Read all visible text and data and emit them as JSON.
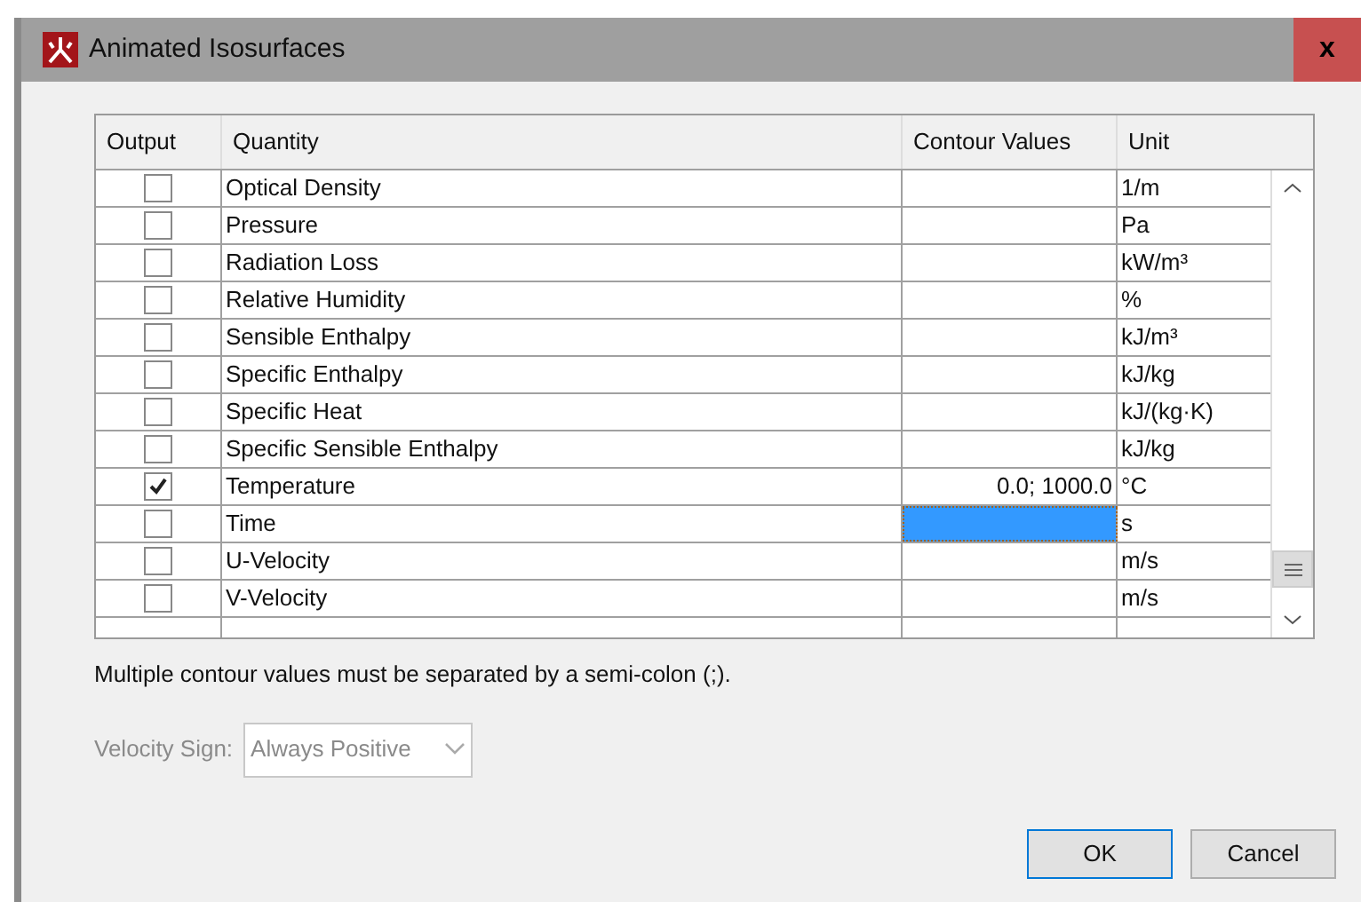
{
  "window": {
    "title": "Animated Isosurfaces",
    "close": "x"
  },
  "table": {
    "columns": [
      "Output",
      "Quantity",
      "Contour Values",
      "Unit"
    ],
    "rows": [
      {
        "checked": false,
        "quantity": "Optical Density",
        "contour_values": "",
        "unit": "1/m",
        "focused": false
      },
      {
        "checked": false,
        "quantity": "Pressure",
        "contour_values": "",
        "unit": "Pa",
        "focused": false
      },
      {
        "checked": false,
        "quantity": "Radiation Loss",
        "contour_values": "",
        "unit": "kW/m³",
        "focused": false
      },
      {
        "checked": false,
        "quantity": "Relative Humidity",
        "contour_values": "",
        "unit": "%",
        "focused": false
      },
      {
        "checked": false,
        "quantity": "Sensible Enthalpy",
        "contour_values": "",
        "unit": "kJ/m³",
        "focused": false
      },
      {
        "checked": false,
        "quantity": "Specific Enthalpy",
        "contour_values": "",
        "unit": "kJ/kg",
        "focused": false
      },
      {
        "checked": false,
        "quantity": "Specific Heat",
        "contour_values": "",
        "unit": "kJ/(kg·K)",
        "focused": false
      },
      {
        "checked": false,
        "quantity": "Specific Sensible Enthalpy",
        "contour_values": "",
        "unit": "kJ/kg",
        "focused": false
      },
      {
        "checked": true,
        "quantity": "Temperature",
        "contour_values": "0.0; 1000.0",
        "unit": "°C",
        "focused": false
      },
      {
        "checked": false,
        "quantity": "Time",
        "contour_values": "",
        "unit": "s",
        "focused": true
      },
      {
        "checked": false,
        "quantity": "U-Velocity",
        "contour_values": "",
        "unit": "m/s",
        "focused": false
      },
      {
        "checked": false,
        "quantity": "V-Velocity",
        "contour_values": "",
        "unit": "m/s",
        "focused": false
      }
    ]
  },
  "note": "Multiple contour values must be separated by a semi-colon (;).",
  "velocity_sign": {
    "label": "Velocity Sign:",
    "value": "Always Positive",
    "disabled": true
  },
  "buttons": [
    "OK",
    "Cancel"
  ]
}
